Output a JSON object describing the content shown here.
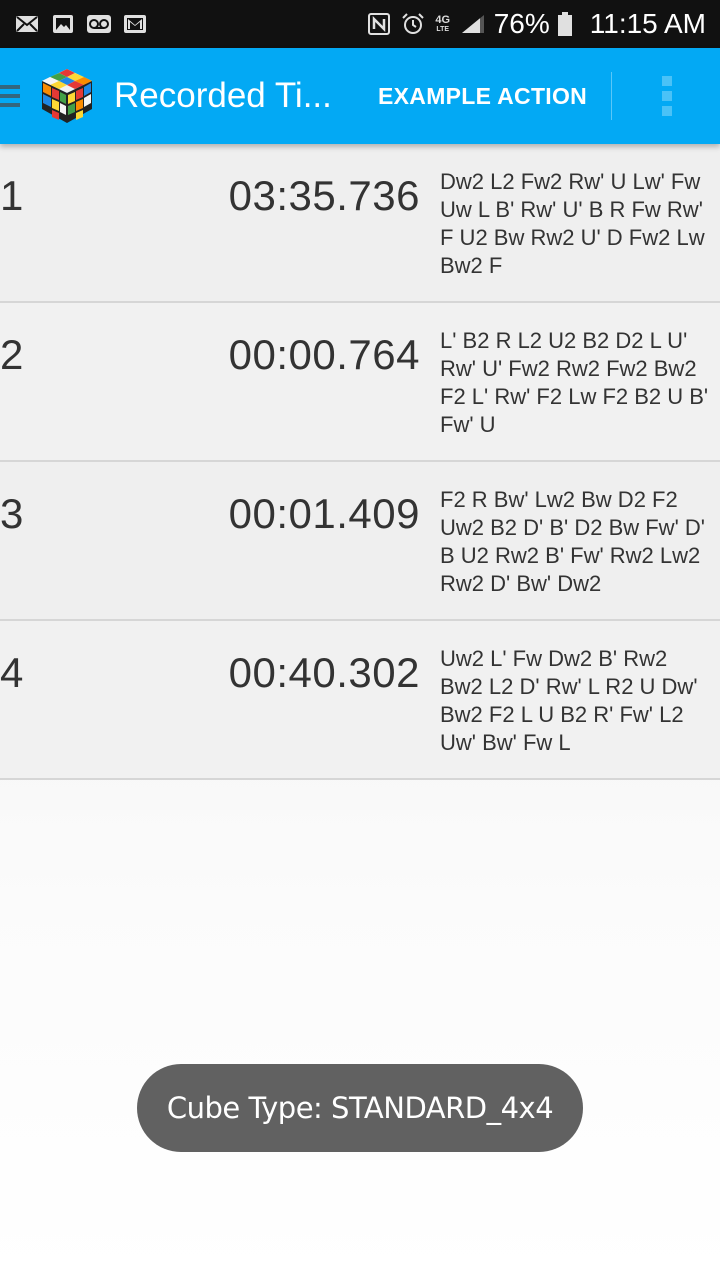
{
  "status_bar": {
    "battery": "76%",
    "time": "11:15 AM",
    "network_type": "4G",
    "network_sub": "LTE",
    "icons": [
      "email-icon",
      "image-icon",
      "voicemail-icon",
      "gmail-icon",
      "nfc-icon",
      "alarm-icon",
      "network-4g-icon",
      "signal-icon",
      "battery-icon"
    ]
  },
  "app_bar": {
    "title": "Recorded Ti...",
    "action_label": "EXAMPLE ACTION",
    "background": "#03a9f4"
  },
  "records": [
    {
      "index": "1",
      "time": "03:35.736",
      "scramble": "Dw2 L2 Fw2 Rw' U Lw' Fw Uw L B' Rw' U' B R Fw Rw' F U2 Bw Rw2 U' D Fw2 Lw Bw2 F"
    },
    {
      "index": "2",
      "time": "00:00.764",
      "scramble": "L' B2 R L2 U2 B2 D2 L U' Rw' U' Fw2 Rw2 Fw2 Bw2 F2 L' Rw' F2 Lw F2 B2 U B' Fw' U"
    },
    {
      "index": "3",
      "time": "00:01.409",
      "scramble": "F2 R Bw' Lw2 Bw D2 F2 Uw2 B2 D' B' D2 Bw Fw' D' B U2 Rw2 B' Fw' Rw2 Lw2 Rw2 D' Bw' Dw2"
    },
    {
      "index": "4",
      "time": "00:40.302",
      "scramble": "Uw2 L' Fw Dw2 B' Rw2 Bw2 L2 D' Rw' L R2 U Dw' Bw2 F2 L U B2 R' Fw' L2 Uw' Bw' Fw L"
    }
  ],
  "toast": {
    "text": "Cube Type: STANDARD_4x4"
  }
}
